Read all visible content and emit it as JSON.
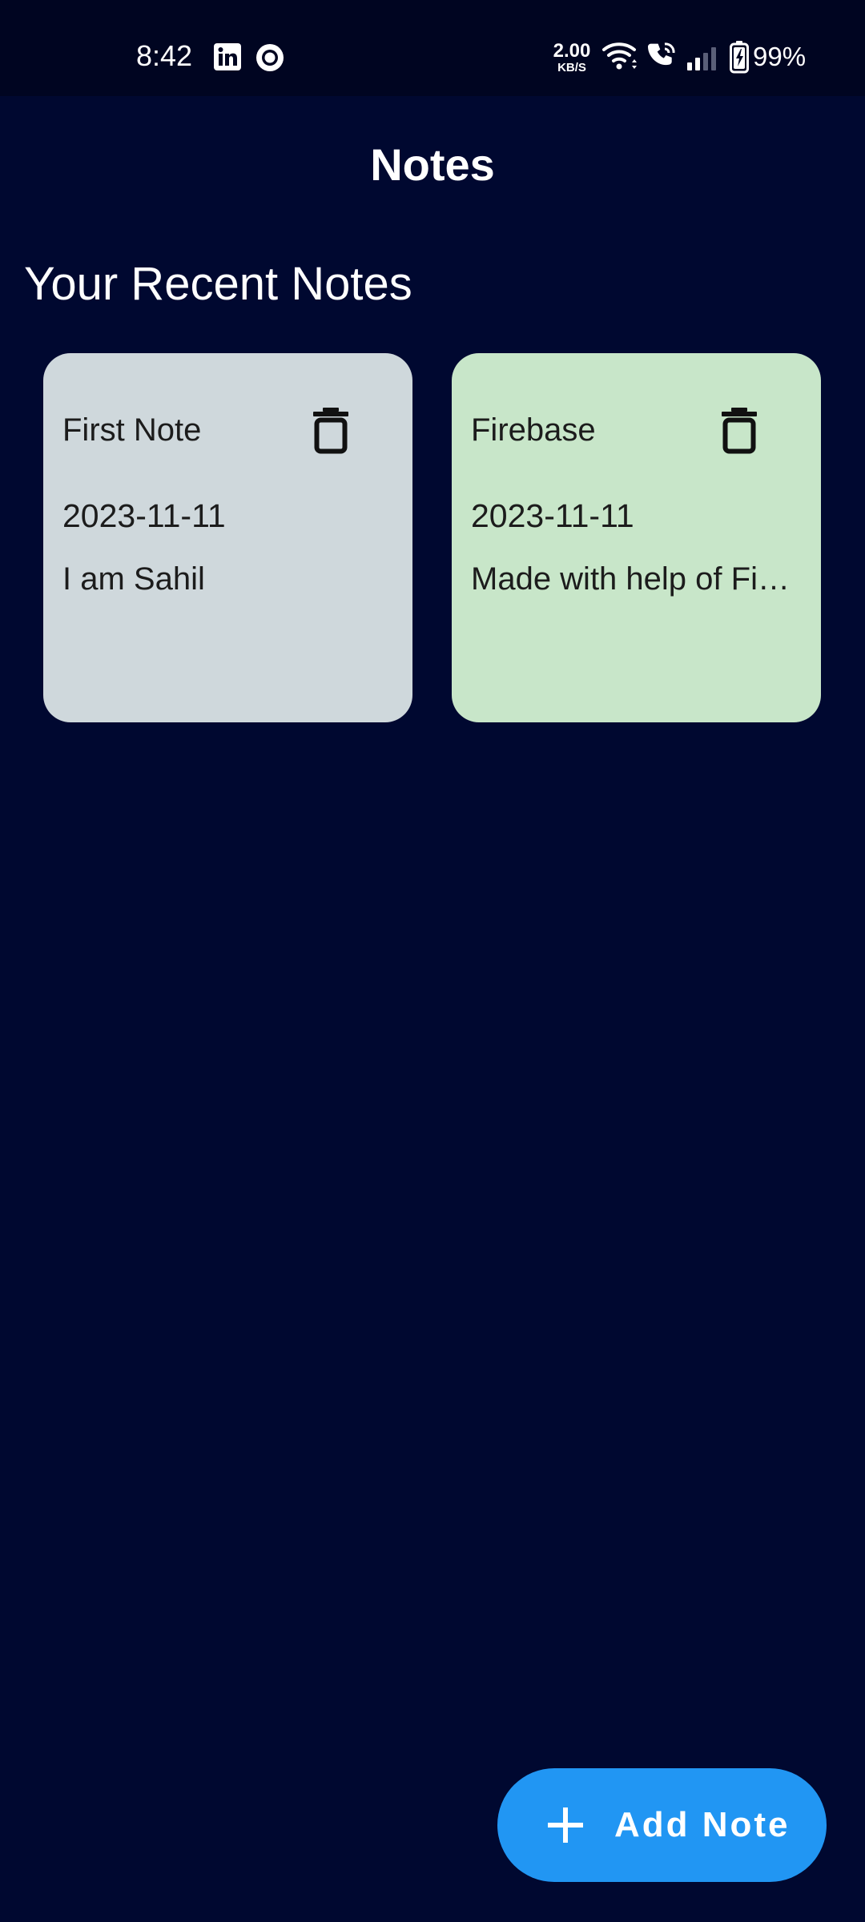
{
  "status_bar": {
    "time": "8:42",
    "notification_icons": [
      "linkedin-icon",
      "record-icon"
    ],
    "network_speed_value": "2.00",
    "network_speed_unit": "KB/S",
    "system_icons": [
      "wifi-icon",
      "volte-call-icon",
      "signal-icon",
      "battery-charging-icon"
    ],
    "battery_percent": "99%"
  },
  "app_bar": {
    "title": "Notes"
  },
  "main": {
    "section_heading": "Your Recent Notes",
    "notes": [
      {
        "title": "First Note",
        "date": "2023-11-11",
        "content": "I am Sahil",
        "color": "#cfd8dc",
        "delete_icon": "trash-icon"
      },
      {
        "title": "Firebase",
        "date": "2023-11-11",
        "content": "Made with help of Fi…",
        "color": "#c8e6c9",
        "delete_icon": "trash-icon"
      }
    ]
  },
  "fab": {
    "icon": "plus-icon",
    "label": "Add Note",
    "color": "#2196f3"
  },
  "colors": {
    "background": "#000830",
    "status_bar": "#000521",
    "text_on_dark": "#ffffff",
    "text_on_card": "#1c1c1c"
  }
}
